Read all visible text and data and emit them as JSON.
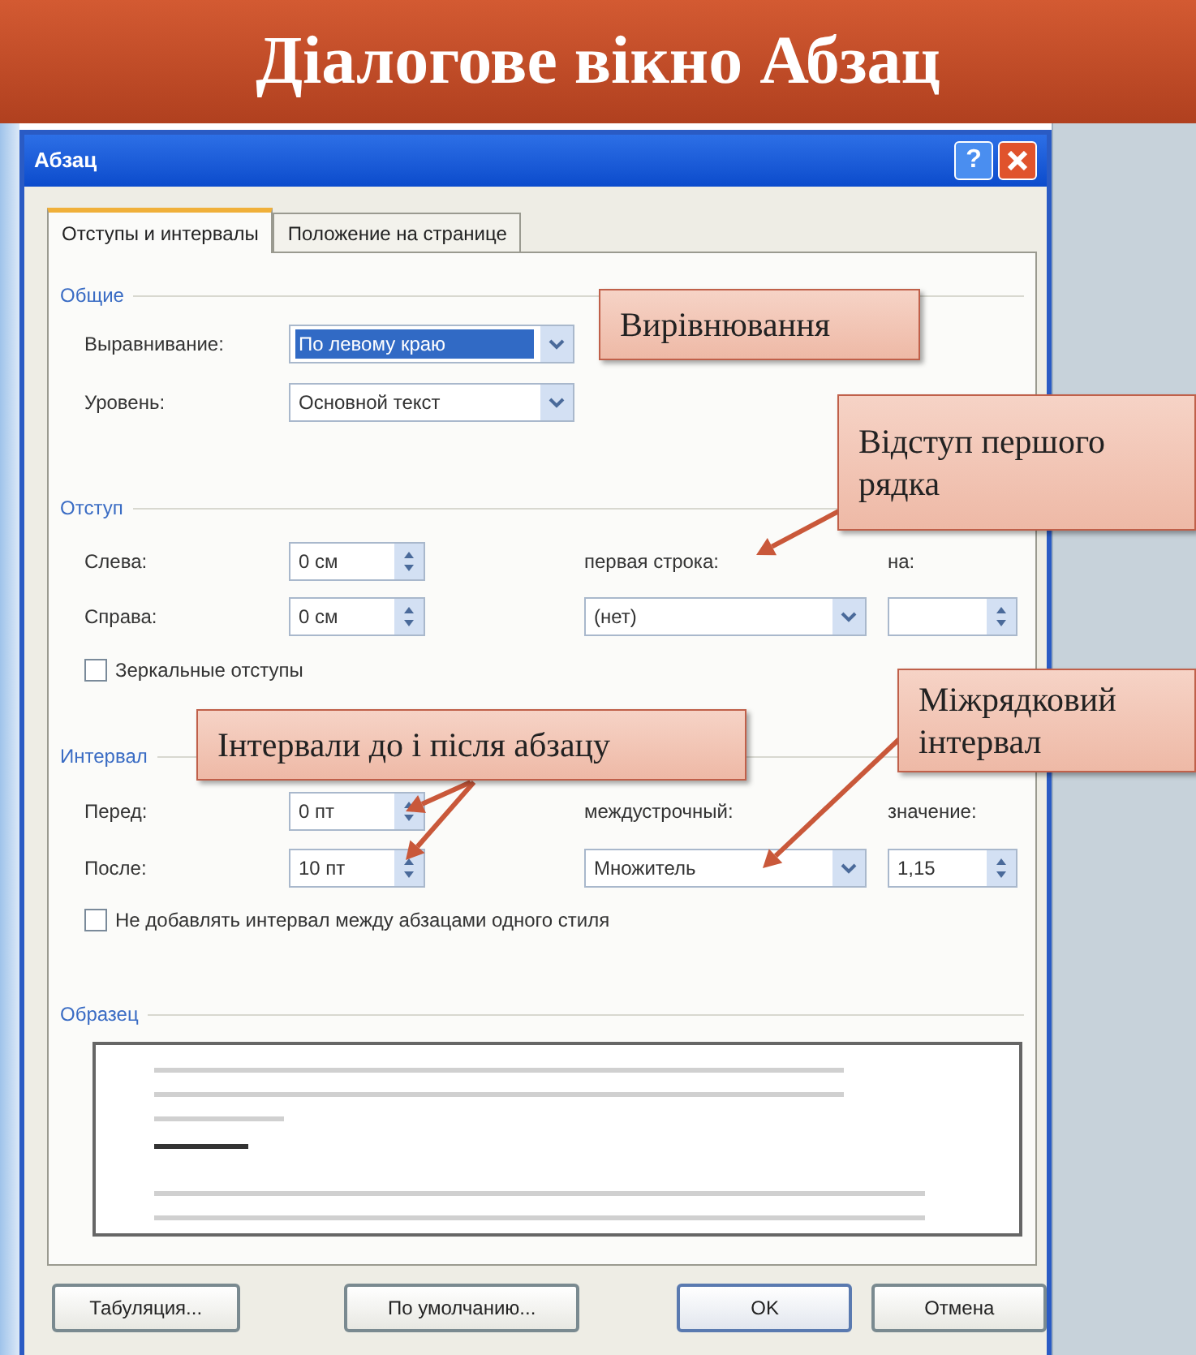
{
  "slide": {
    "title": "Діалогове вікно Абзац"
  },
  "dialog": {
    "title": "Абзац",
    "help_button": "?",
    "tabs": [
      {
        "label": "Отступы и интервалы",
        "selected": true
      },
      {
        "label": "Положение на странице",
        "selected": false
      }
    ],
    "general": {
      "heading": "Общие",
      "alignment": {
        "label": "Выравнивание:",
        "value": "По левому краю",
        "highlighted": true
      },
      "outline_level": {
        "label": "Уровень:",
        "value": "Основной текст",
        "highlighted": false
      }
    },
    "indent": {
      "heading": "Отступ",
      "left": {
        "label": "Слева:",
        "value": "0 см"
      },
      "right": {
        "label": "Справа:",
        "value": "0 см"
      },
      "first_line": {
        "label": "первая строка:",
        "value": "(нет)"
      },
      "by": {
        "label": "на:"
      },
      "mirror": {
        "label": "Зеркальные отступы",
        "checked": false
      }
    },
    "spacing": {
      "heading": "Интервал",
      "before": {
        "label": "Перед:",
        "value": "0 пт"
      },
      "after": {
        "label": "После:",
        "value": "10 пт"
      },
      "line_spacing": {
        "label": "междустрочный:",
        "value": "Множитель"
      },
      "at": {
        "label": "значение:",
        "value": "1,15"
      },
      "dont_add": {
        "label": "Не добавлять интервал между абзацами одного стиля",
        "checked": false
      }
    },
    "preview": {
      "heading": "Образец"
    },
    "buttons": [
      {
        "label": "Табуляция...",
        "default": false
      },
      {
        "label": "По умолчанию...",
        "default": false
      },
      {
        "label": "OK",
        "default": true
      },
      {
        "label": "Отмена",
        "default": false
      }
    ]
  },
  "callouts": [
    {
      "text": "Вирівнювання"
    },
    {
      "text": "Відступ першого рядка"
    },
    {
      "text": "Інтервали до і після абзацу"
    },
    {
      "text": "Міжрядковий інтервал"
    }
  ]
}
